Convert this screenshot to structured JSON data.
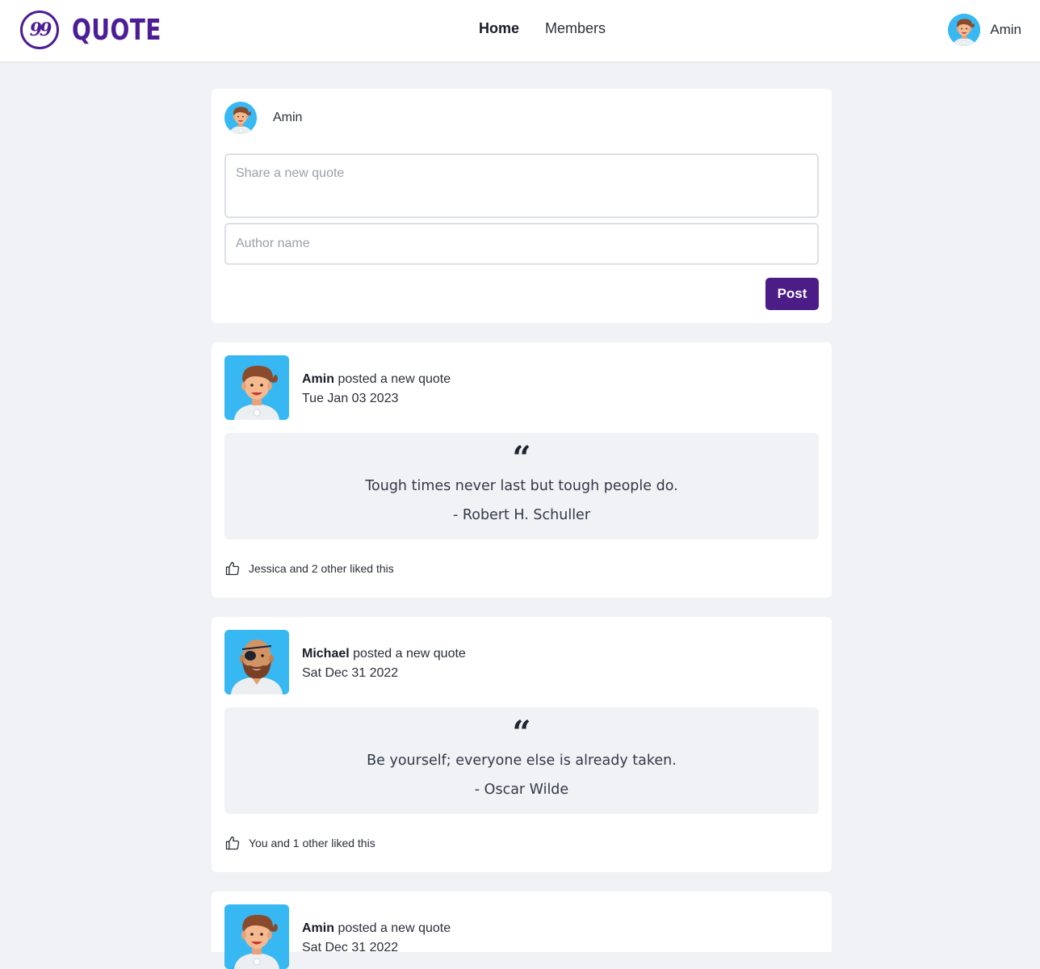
{
  "header": {
    "brand": "QUOTE",
    "logo_glyph": "99",
    "nav": [
      {
        "label": "Home",
        "active": true
      },
      {
        "label": "Members",
        "active": false
      }
    ],
    "user_name": "Amin"
  },
  "composer": {
    "user_name": "Amin",
    "quote_placeholder": "Share a new quote",
    "author_placeholder": "Author name",
    "post_label": "Post"
  },
  "posts": [
    {
      "author": "Amin",
      "action": "posted a new quote",
      "date": "Tue Jan 03 2023",
      "quote_mark": "“",
      "quote": "Tough times never last but tough people do.",
      "quote_author": "- Robert H. Schuller",
      "likes": "Jessica and 2 other liked this",
      "avatar": "brown-hair-avatar"
    },
    {
      "author": "Michael",
      "action": "posted a new quote",
      "date": "Sat Dec 31 2022",
      "quote_mark": "“",
      "quote": "Be yourself; everyone else is already taken.",
      "quote_author": "- Oscar Wilde",
      "likes": "You and 1 other liked this",
      "avatar": "eyepatch-bearded-avatar"
    },
    {
      "author": "Amin",
      "action": "posted a new quote",
      "date": "Sat Dec 31 2022",
      "avatar": "brown-hair-avatar"
    }
  ],
  "colors": {
    "brand": "#4c1d95",
    "button": "#4c1d87",
    "background": "#f0f2f6",
    "avatar_bg": "#38b8f2"
  }
}
